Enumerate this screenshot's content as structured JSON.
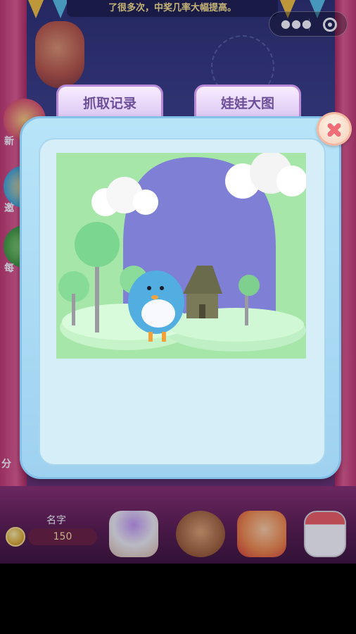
{
  "marquee": {
    "text": "了很多次，中奖几率大幅提高。"
  },
  "sidebar": {
    "items": [
      {
        "label": "新"
      },
      {
        "label": "邀"
      },
      {
        "label": "每"
      }
    ]
  },
  "left_edge_label": "分",
  "footer": {
    "name_label": "名字",
    "coin_count": "150"
  },
  "tabs": {
    "catch_records": "抓取记录",
    "doll_image": "娃娃大图"
  },
  "colors": {
    "modal_bg": "#b8e4f8",
    "modal_inner": "#d5eef8",
    "tab_text": "#6d4f9a",
    "close_x": "#f06d78"
  },
  "icons": [
    "more-icon",
    "target-icon",
    "close-icon",
    "coin-icon",
    "candy-basket-icon",
    "bear-icon",
    "friends-icon",
    "calendar-icon"
  ]
}
